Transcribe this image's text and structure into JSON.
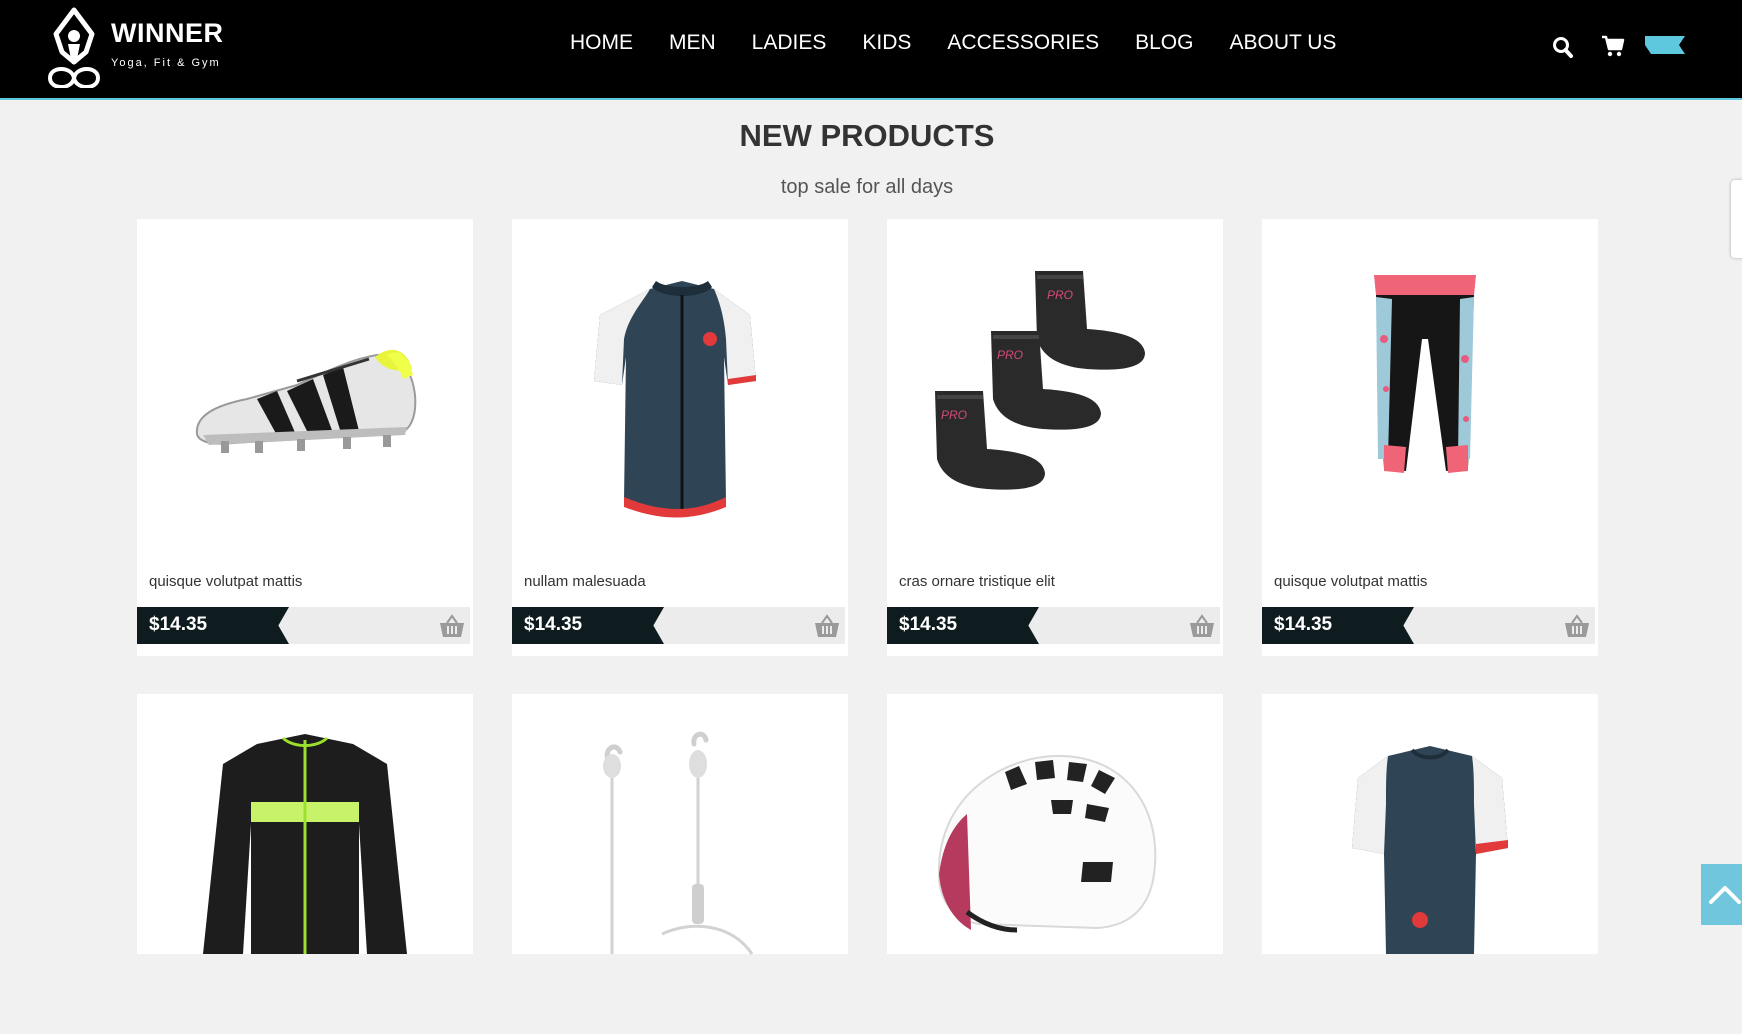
{
  "brand": {
    "name": "WINNER",
    "tagline": "Yoga, Fit & Gym"
  },
  "nav": {
    "items": [
      "HOME",
      "MEN",
      "LADIES",
      "KIDS",
      "ACCESSORIES",
      "BLOG",
      "ABOUT US"
    ]
  },
  "header_icons": [
    "search-icon",
    "cart-icon",
    "flag-tag-icon"
  ],
  "section": {
    "title": "NEW PRODUCTS",
    "subtitle": "top sale for all days"
  },
  "products": [
    {
      "name": "quisque volutpat mattis",
      "price": "$14.35",
      "image": "football-boot"
    },
    {
      "name": "nullam malesuada",
      "price": "$14.35",
      "image": "cycling-jersey"
    },
    {
      "name": "cras ornare tristique elit",
      "price": "$14.35",
      "image": "socks"
    },
    {
      "name": "quisque volutpat mattis",
      "price": "$14.35",
      "image": "leggings"
    },
    {
      "image": "long-sleeve-cycling-jacket"
    },
    {
      "image": "earphones"
    },
    {
      "image": "helmet"
    },
    {
      "image": "cycling-jersey-back"
    }
  ],
  "colors": {
    "header_bg": "#000000",
    "accent": "#5ec8df",
    "page_bg": "#f1f1f1",
    "price_tag": "#0f1c1f",
    "back_to_top": "#70c6dc"
  }
}
